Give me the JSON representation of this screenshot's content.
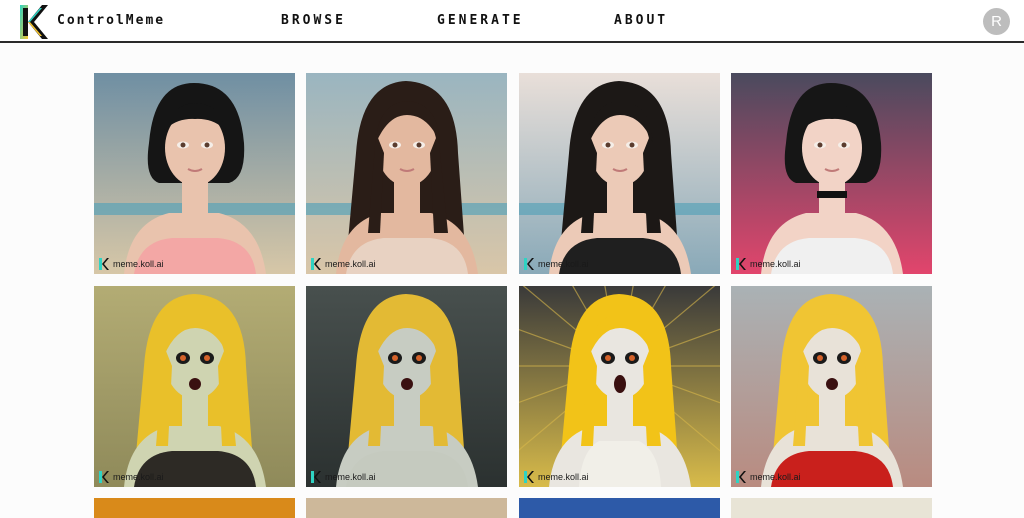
{
  "header": {
    "brand": "ControlMeme",
    "nav": [
      "BROWSE",
      "GENERATE",
      "ABOUT"
    ],
    "avatar_initial": "R"
  },
  "gallery": {
    "watermark": "meme.koll.ai",
    "items": [
      {
        "subject": "dark bob hair woman on beach",
        "bg": "#6f8fa3",
        "bg2": "#d7c7a7",
        "hair": "#151515",
        "skin": "#e9c3ad",
        "clothes": "#f3a7a5"
      },
      {
        "subject": "long brown hair woman on beach",
        "bg": "#9ab5c0",
        "bg2": "#d9c6a8",
        "hair": "#2a1d17",
        "skin": "#e3b89f",
        "clothes": "#e8d2c2"
      },
      {
        "subject": "dark hair woman at sunset beach",
        "bg": "#e9dfd9",
        "bg2": "#89a9b8",
        "hair": "#1c1816",
        "skin": "#eccab7",
        "clothes": "#1f1f1f"
      },
      {
        "subject": "bob hair woman with choker neon light",
        "bg": "#4a4a5e",
        "bg2": "#e2456c",
        "hair": "#161616",
        "skin": "#f2d3c6",
        "clothes": "#f0f0f0"
      },
      {
        "subject": "blonde zombie girl olive background",
        "bg": "#b3ac74",
        "bg2": "#8f8a5a",
        "hair": "#e9c02a",
        "skin": "#cfd4b1",
        "clothes": "#2d2a25"
      },
      {
        "subject": "blonde zombie girl dark teal background",
        "bg": "#48504e",
        "bg2": "#2b3130",
        "hair": "#e3ba34",
        "skin": "#c7ccc2",
        "clothes": "#c5cabf"
      },
      {
        "subject": "screaming blonde girl with rays",
        "bg": "#3a3a3a",
        "bg2": "#d8bb4a",
        "hair": "#f2c318",
        "skin": "#e9e6e0",
        "clothes": "#f1efe8"
      },
      {
        "subject": "blonde girl in red shirt",
        "bg": "#aab2b5",
        "bg2": "#b98b80",
        "hair": "#f0c533",
        "skin": "#e8e2d8",
        "clothes": "#c9201c"
      }
    ],
    "partial_row": [
      "#d98a1a",
      "#cdb89a",
      "#2d5aa8",
      "#e8e4d6"
    ]
  },
  "colors": {
    "logo_cyan": "#2fd3c3",
    "logo_yellow": "#f4c430",
    "logo_black": "#111111",
    "avatar_bg": "#bdbdbd"
  }
}
